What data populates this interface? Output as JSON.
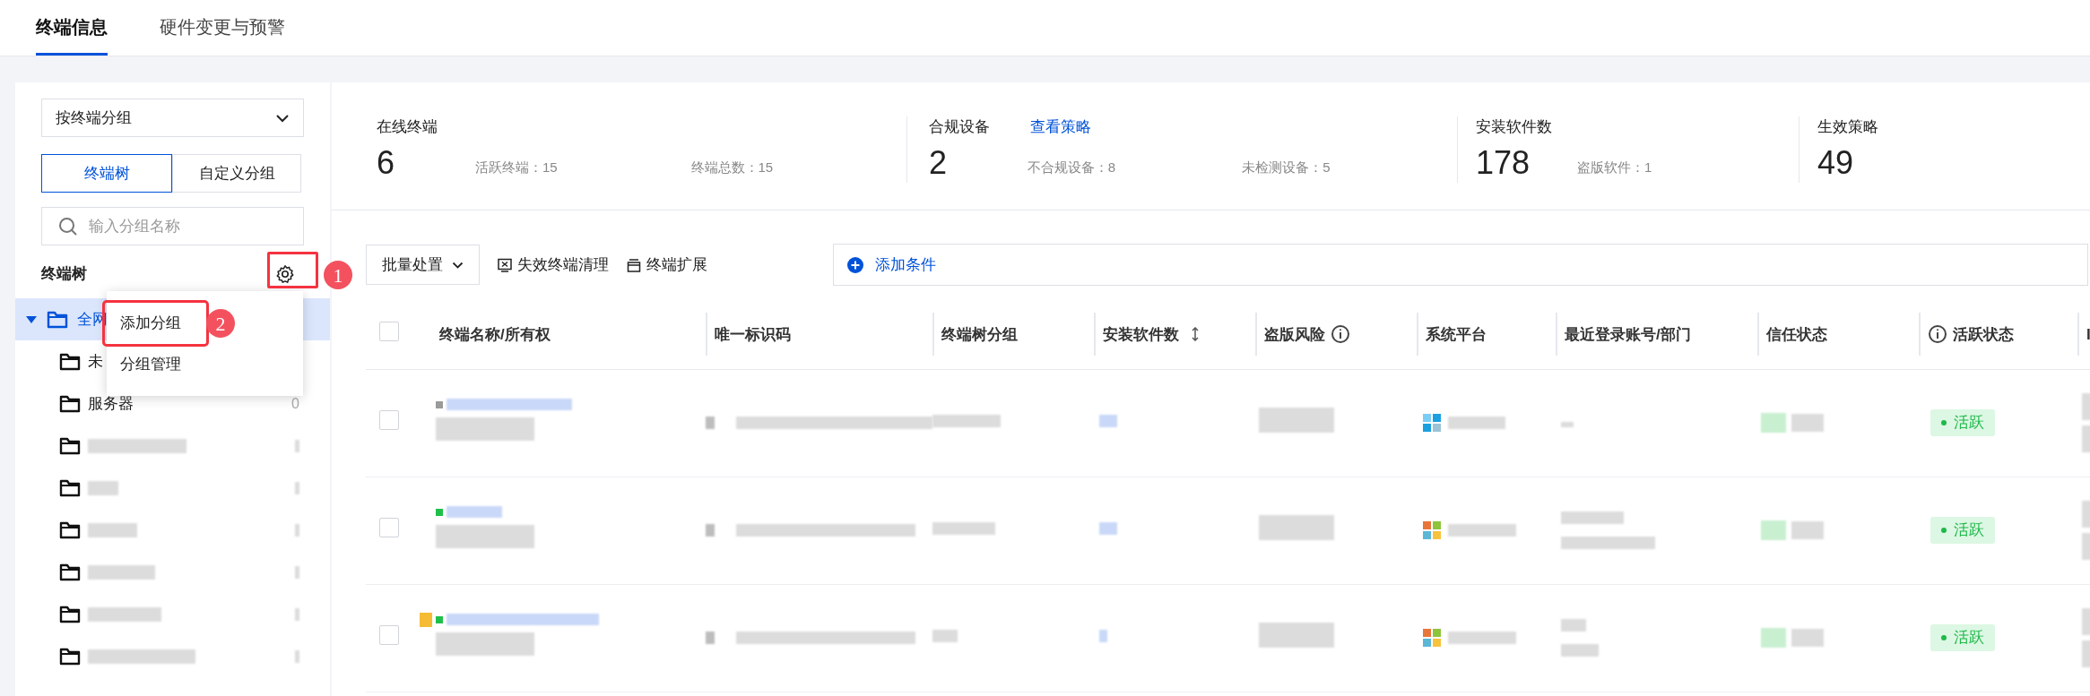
{
  "tabs": [
    {
      "label": "终端信息",
      "selected": true
    },
    {
      "label": "硬件变更与预警",
      "selected": false
    }
  ],
  "sidebar": {
    "group_by": "按终端分组",
    "views": [
      {
        "label": "终端树",
        "selected": true
      },
      {
        "label": "自定义分组",
        "selected": false
      }
    ],
    "search": {
      "placeholder": "输入分组名称"
    },
    "tree_title": "终端树",
    "tree": [
      {
        "name": "全网",
        "expanded": true,
        "selected": true,
        "children": [
          {
            "kind": "text",
            "name": "未"
          },
          {
            "kind": "text",
            "name": "服务器",
            "count": "0"
          },
          {
            "kind": "redacted"
          },
          {
            "kind": "redacted"
          },
          {
            "kind": "redacted"
          },
          {
            "kind": "redacted"
          },
          {
            "kind": "redacted"
          },
          {
            "kind": "redacted"
          }
        ]
      }
    ]
  },
  "group_menu": [
    {
      "label": "添加分组",
      "highlighted": true
    },
    {
      "label": "分组管理",
      "highlighted": false
    }
  ],
  "annotations": [
    {
      "number": "1"
    },
    {
      "number": "2"
    }
  ],
  "stats": [
    {
      "label": "在线终端",
      "value": "6",
      "details": [
        "活跃终端：15",
        "终端总数：15"
      ]
    },
    {
      "label": "合规设备",
      "link": "查看策略",
      "value": "2",
      "details": [
        "不合规设备：8",
        "未检测设备：5"
      ]
    },
    {
      "label": "安装软件数",
      "value": "178",
      "details": [
        "盗版软件：1"
      ]
    },
    {
      "label": "生效策略",
      "value": "49"
    }
  ],
  "toolbar": {
    "batch": "批量处置",
    "actions": [
      {
        "label": "失效终端清理",
        "kind": "clear"
      },
      {
        "label": "终端扩展",
        "kind": "expand"
      }
    ],
    "filter": "添加条件"
  },
  "table": {
    "header_checked": false,
    "columns": [
      {
        "label": "终端名称/所有权",
        "kind": "plain"
      },
      {
        "label": "唯一标识码",
        "kind": "plain"
      },
      {
        "label": "终端树分组",
        "kind": "plain"
      },
      {
        "label": "安装软件数",
        "kind": "sortable"
      },
      {
        "label": "盗版风险",
        "kind": "info-after"
      },
      {
        "label": "系统平台",
        "kind": "plain"
      },
      {
        "label": "最近登录账号/部门",
        "kind": "plain"
      },
      {
        "label": "信任状态",
        "kind": "plain"
      },
      {
        "label": "活跃状态",
        "kind": "info-before"
      },
      {
        "label": "I",
        "kind": "plain"
      }
    ],
    "rows": [
      {
        "checked": false,
        "online": false,
        "flagged": false,
        "kind": "plain",
        "status": "活跃"
      },
      {
        "checked": false,
        "online": true,
        "flagged": false,
        "kind": "colored",
        "status": "活跃"
      },
      {
        "checked": false,
        "online": true,
        "flagged": true,
        "kind": "colored",
        "status": "活跃"
      }
    ]
  }
}
